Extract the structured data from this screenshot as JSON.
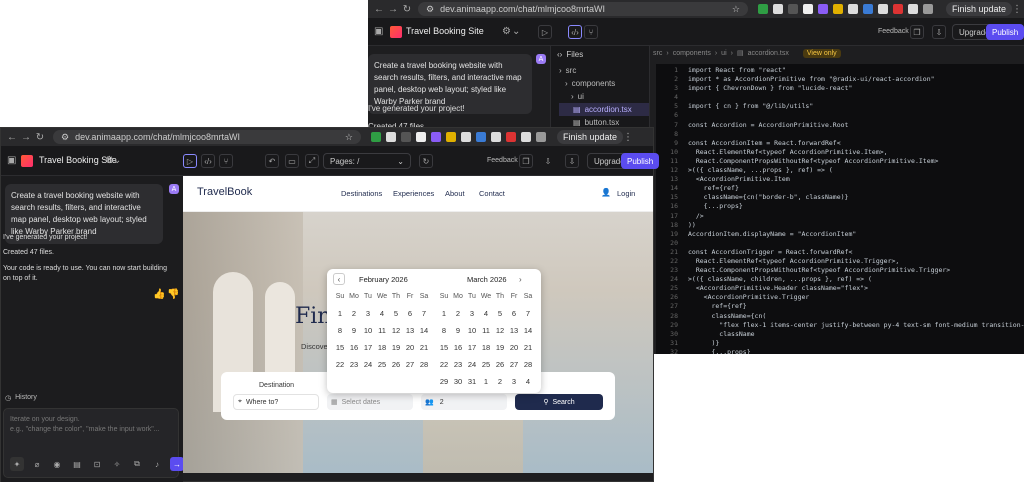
{
  "back_window": {
    "url": "dev.animaapp.com/chat/mlmjcoo8mrtaWI",
    "finish_update": "Finish update",
    "project_title": "Travel Booking Site",
    "feedback": "Feedback",
    "upgrade": "Upgrade",
    "publish": "Publish",
    "chat_prompt": "Create a travel booking website with search results, filters, and interactive map panel, desktop web layout; styled like Warby Parker brand",
    "avatar_letter": "A",
    "generated": "I've generated your project!",
    "created": "Created 47 files.",
    "files_label": "Files",
    "tree": [
      "src",
      "components",
      "ui",
      "accordion.tsx",
      "button.tsx"
    ],
    "breadcrumb": [
      "src",
      "components",
      "ui",
      "accordion.tsx"
    ],
    "view_only": "View only",
    "code_lines": [
      "import React from \"react\"",
      "import * as AccordionPrimitive from \"@radix-ui/react-accordion\"",
      "import { ChevronDown } from \"lucide-react\"",
      "",
      "import { cn } from \"@/lib/utils\"",
      "",
      "const Accordion = AccordionPrimitive.Root",
      "",
      "const AccordionItem = React.forwardRef<",
      "  React.ElementRef<typeof AccordionPrimitive.Item>,",
      "  React.ComponentPropsWithoutRef<typeof AccordionPrimitive.Item>",
      ">(({ className, ...props }, ref) => (",
      "  <AccordionPrimitive.Item",
      "    ref={ref}",
      "    className={cn(\"border-b\", className)}",
      "    {...props}",
      "  />",
      "))",
      "AccordionItem.displayName = \"AccordionItem\"",
      "",
      "const AccordionTrigger = React.forwardRef<",
      "  React.ElementRef<typeof AccordionPrimitive.Trigger>,",
      "  React.ComponentPropsWithoutRef<typeof AccordionPrimitive.Trigger>",
      ">(({ className, children, ...props }, ref) => (",
      "  <AccordionPrimitive.Header className=\"flex\">",
      "    <AccordionPrimitive.Trigger",
      "      ref={ref}",
      "      className={cn(",
      "        \"flex flex-1 items-center justify-between py-4 text-sm font-medium transition-all hover:underline text-",
      "        className",
      "      )}",
      "      {...props}",
      "    >",
      "      {children}",
      "      <ChevronDown className=\"h-4 w-4 shrink-0 text-muted-foreground transition-transform duration-200\" />",
      "    </AccordionPrimitive.Trigger>"
    ]
  },
  "front_window": {
    "url": "dev.animaapp.com/chat/mlmjcoo8mrtaWI",
    "finish_update": "Finish update",
    "project_title": "Travel Booking Site",
    "pages_label": "Pages:",
    "pages_value": "/",
    "feedback": "Feedback",
    "upgrade": "Upgrade",
    "publish": "Publish",
    "chat_prompt": "Create a travel booking website with search results, filters, and interactive map panel, desktop web layout; styled like Warby Parker brand",
    "avatar_letter": "A",
    "generated": "I've generated your project!",
    "created": "Created 47 files.",
    "ready": "Your code is ready to use. You can now start building on top of it.",
    "history": "History",
    "input_placeholder": "Iterate on your design.\ne.g., \"change the color\", \"make the input work\"..."
  },
  "site": {
    "brand": "TravelBook",
    "nav": [
      "Destinations",
      "Experiences",
      "About",
      "Contact"
    ],
    "login": "Login",
    "hero_partial": "Find",
    "discover_partial": "Discover",
    "destination_label": "Destination",
    "where_placeholder": "Where to?",
    "dates_placeholder": "Select dates",
    "guests_value": "2",
    "search_button": "Search"
  },
  "calendar": {
    "weekdays": [
      "Su",
      "Mo",
      "Tu",
      "We",
      "Th",
      "Fr",
      "Sa"
    ],
    "months": [
      {
        "title": "February 2026",
        "days": [
          "1",
          "2",
          "3",
          "4",
          "5",
          "6",
          "7",
          "8",
          "9",
          "10",
          "11",
          "12",
          "13",
          "14",
          "15",
          "16",
          "17",
          "18",
          "19",
          "20",
          "21",
          "22",
          "23",
          "24",
          "25",
          "26",
          "27",
          "28"
        ]
      },
      {
        "title": "March 2026",
        "days": [
          "1",
          "2",
          "3",
          "4",
          "5",
          "6",
          "7",
          "8",
          "9",
          "10",
          "11",
          "12",
          "13",
          "14",
          "15",
          "16",
          "17",
          "18",
          "19",
          "20",
          "21",
          "22",
          "23",
          "24",
          "25",
          "26",
          "27",
          "28",
          "29",
          "30",
          "31",
          "1",
          "2",
          "3",
          "4"
        ]
      }
    ]
  },
  "colors": {
    "accent": "#5b4cf0",
    "search_btn": "#1f2a4d",
    "logo": "#ff4b3e"
  }
}
